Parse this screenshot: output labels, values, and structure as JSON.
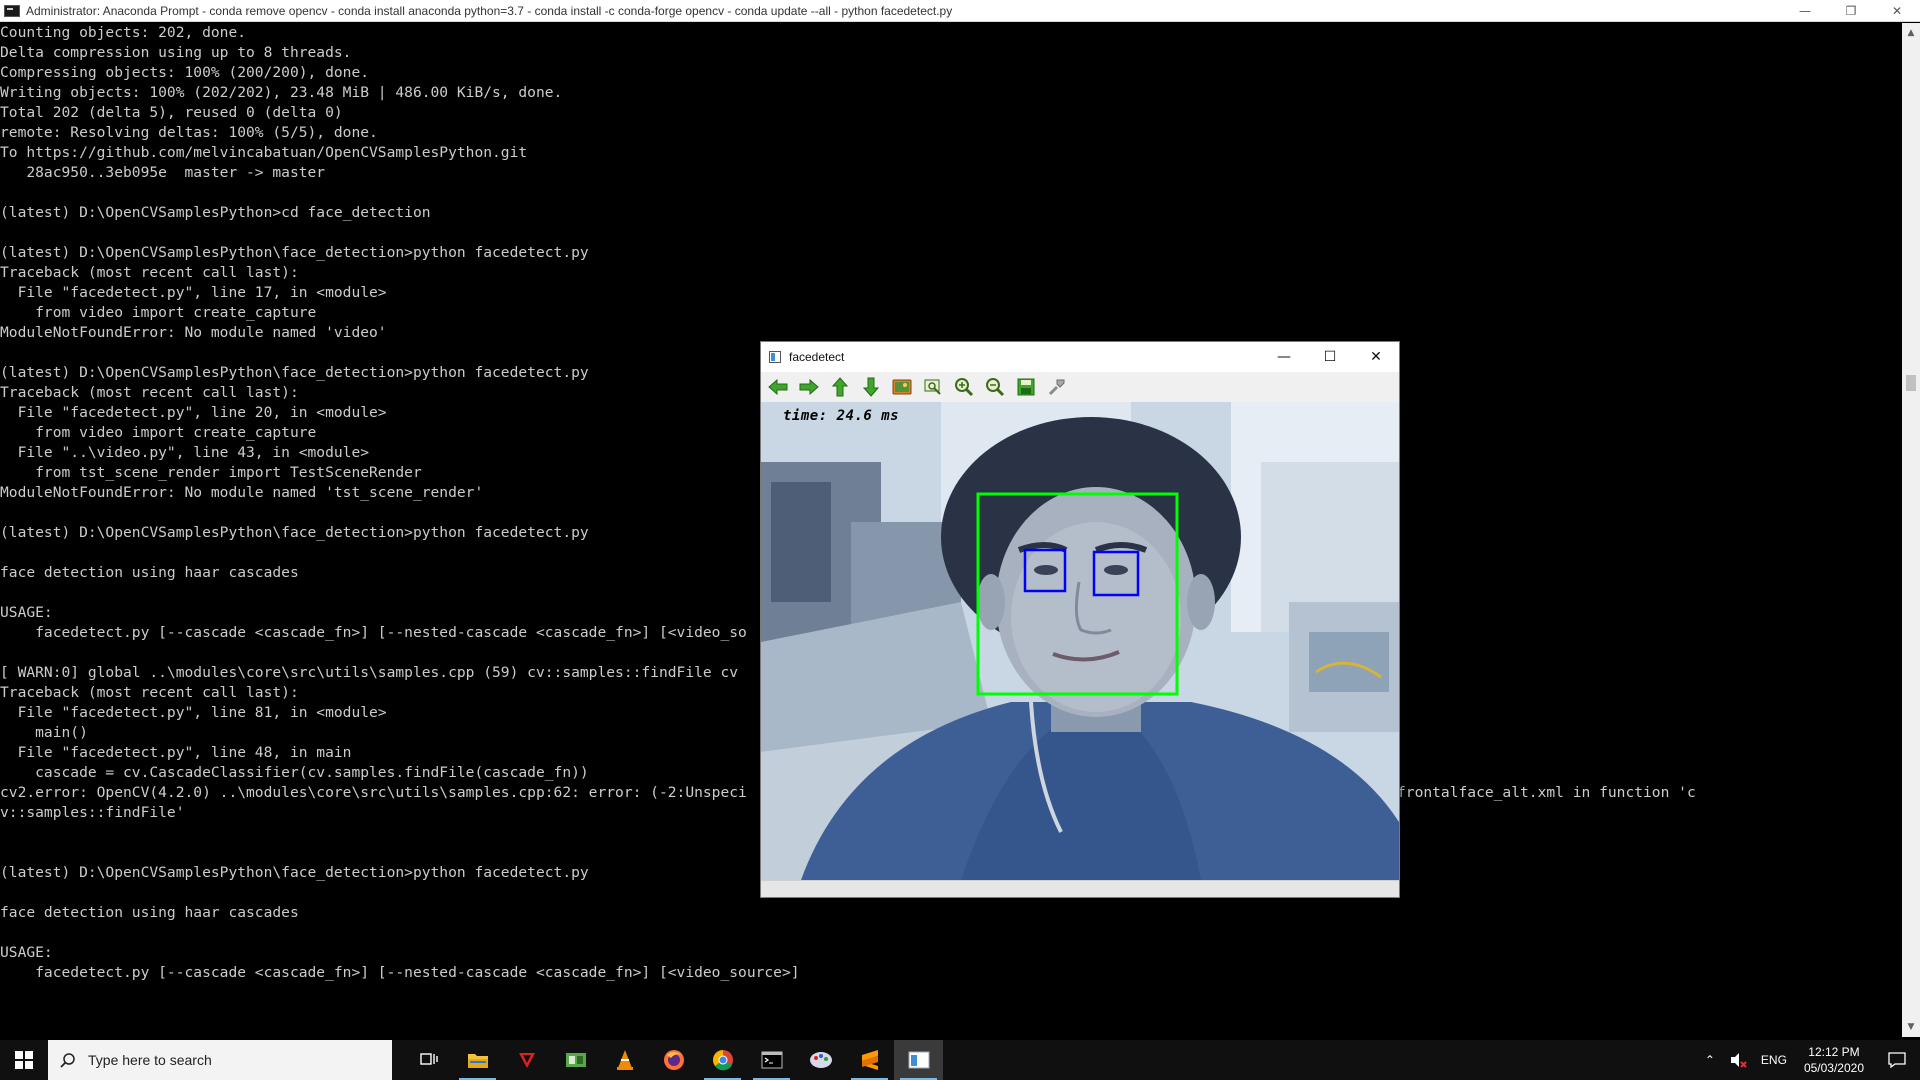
{
  "console": {
    "title": "Administrator: Anaconda Prompt - conda  remove opencv - conda  install anaconda python=3.7  - conda  install -c conda-forge opencv - conda  update --all - python  facedetect.py",
    "lines": [
      "Counting objects: 202, done.",
      "Delta compression using up to 8 threads.",
      "Compressing objects: 100% (200/200), done.",
      "Writing objects: 100% (202/202), 23.48 MiB | 486.00 KiB/s, done.",
      "Total 202 (delta 5), reused 0 (delta 0)",
      "remote: Resolving deltas: 100% (5/5), done.",
      "To https://github.com/melvincabatuan/OpenCVSamplesPython.git",
      "   28ac950..3eb095e  master -> master",
      "",
      "(latest) D:\\OpenCVSamplesPython>cd face_detection",
      "",
      "(latest) D:\\OpenCVSamplesPython\\face_detection>python facedetect.py",
      "Traceback (most recent call last):",
      "  File \"facedetect.py\", line 17, in <module>",
      "    from video import create_capture",
      "ModuleNotFoundError: No module named 'video'",
      "",
      "(latest) D:\\OpenCVSamplesPython\\face_detection>python facedetect.py",
      "Traceback (most recent call last):",
      "  File \"facedetect.py\", line 20, in <module>",
      "    from video import create_capture",
      "  File \"..\\video.py\", line 43, in <module>",
      "    from tst_scene_render import TestSceneRender",
      "ModuleNotFoundError: No module named 'tst_scene_render'",
      "",
      "(latest) D:\\OpenCVSamplesPython\\face_detection>python facedetect.py",
      "",
      "face detection using haar cascades",
      "",
      "USAGE:",
      "    facedetect.py [--cascade <cascade_fn>] [--nested-cascade <cascade_fn>] [<video_so",
      "",
      "[ WARN:0] global ..\\modules\\core\\src\\utils\\samples.cpp (59) cv::samples::findFile cv                                                    ml') => ''",
      "Traceback (most recent call last):",
      "  File \"facedetect.py\", line 81, in <module>",
      "    main()",
      "  File \"facedetect.py\", line 48, in main",
      "    cascade = cv.CascadeClassifier(cv.samples.findFile(cascade_fn))",
      "cv2.error: OpenCV(4.2.0) ..\\modules\\core\\src\\utils\\samples.cpp:62: error: (-2:Unspeci                                                    rcascades/haarcascade_frontalface_alt.xml in function 'c",
      "v::samples::findFile'",
      "",
      "",
      "(latest) D:\\OpenCVSamplesPython\\face_detection>python facedetect.py",
      "",
      "face detection using haar cascades",
      "",
      "USAGE:",
      "    facedetect.py [--cascade <cascade_fn>] [--nested-cascade <cascade_fn>] [<video_source>]"
    ]
  },
  "facedetect": {
    "title": "facedetect",
    "time_text": "time: 24.6 ms",
    "toolbar_icons": [
      "arrow-left-icon",
      "arrow-right-icon",
      "arrow-up-icon",
      "arrow-down-icon",
      "image-icon",
      "zoom-fit-icon",
      "zoom-in-icon",
      "zoom-out-icon",
      "save-icon",
      "properties-icon"
    ],
    "face_box_color": "#00ff00",
    "eye_box_color": "#0000ff"
  },
  "taskbar": {
    "search_placeholder": "Type here to search",
    "language": "ENG",
    "time": "12:12 PM",
    "date": "05/03/2020"
  }
}
